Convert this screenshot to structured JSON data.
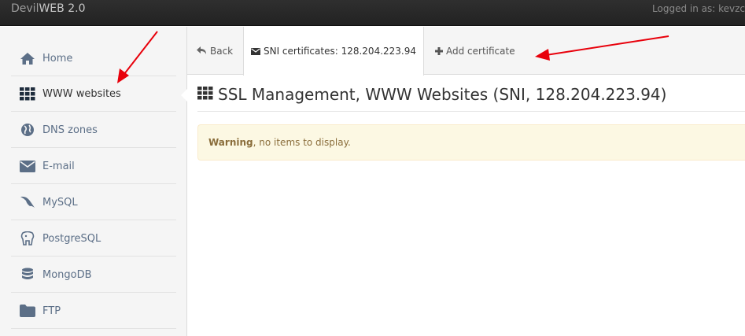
{
  "topbar": {
    "brand_prefix": "Devil",
    "brand_suffix": "WEB 2.0",
    "logged_in": "Logged in as: kevzc"
  },
  "sidebar": {
    "items": [
      {
        "label": "Home",
        "icon": "home-icon"
      },
      {
        "label": "WWW websites",
        "icon": "grid-icon",
        "active": true
      },
      {
        "label": "DNS zones",
        "icon": "globe-icon"
      },
      {
        "label": "E-mail",
        "icon": "envelope-icon"
      },
      {
        "label": "MySQL",
        "icon": "dolphin-icon"
      },
      {
        "label": "PostgreSQL",
        "icon": "elephant-icon"
      },
      {
        "label": "MongoDB",
        "icon": "database-icon"
      },
      {
        "label": "FTP",
        "icon": "folder-icon"
      }
    ]
  },
  "tabs": {
    "back": "Back",
    "sni": "SNI certificates: 128.204.223.94",
    "add": "Add certificate"
  },
  "main": {
    "title": "SSL Management, WWW Websites (SNI, 128.204.223.94)"
  },
  "alert": {
    "strong": "Warning",
    "text": ", no items to display."
  },
  "colors": {
    "topbar": "#222222",
    "sidebar_bg": "#f5f5f5",
    "link": "#5c6f87",
    "alert_bg": "#fcf8e3",
    "alert_text": "#8a6d3b",
    "arrow": "#e8000b"
  }
}
